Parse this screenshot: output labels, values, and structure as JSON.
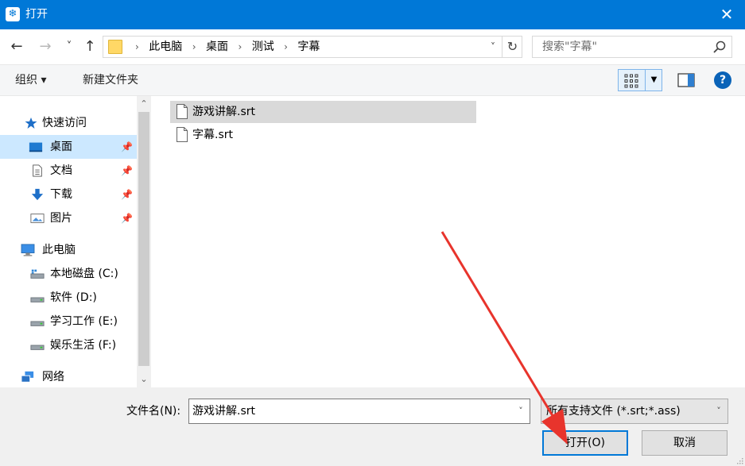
{
  "window": {
    "title": "打开",
    "close_glyph": "✕",
    "app_icon_glyph": "❄"
  },
  "nav": {
    "back_glyph": "←",
    "forward_glyph": "→",
    "recent_glyph": "˅",
    "up_glyph": "↑",
    "breadcrumb": [
      "此电脑",
      "桌面",
      "测试",
      "字幕"
    ],
    "breadcrumb_sep": "›",
    "dropdown_glyph": "˅",
    "refresh_glyph": "↻",
    "search_placeholder": "搜索\"字幕\""
  },
  "toolbar": {
    "organize": "组织 ▾",
    "new_folder": "新建文件夹",
    "view_dd_glyph": "▼",
    "help_glyph": "?"
  },
  "sidebar": {
    "scroll_up": "⌃",
    "scroll_down": "⌄",
    "pin_glyph": "📌",
    "items": [
      {
        "label": "快速访问",
        "icon": "star-icon"
      },
      {
        "label": "桌面",
        "icon": "desktop-icon",
        "pinned": true,
        "selected": true
      },
      {
        "label": "文档",
        "icon": "document-icon",
        "pinned": true
      },
      {
        "label": "下载",
        "icon": "download-icon",
        "pinned": true
      },
      {
        "label": "图片",
        "icon": "picture-icon",
        "pinned": true
      },
      {
        "label": "此电脑",
        "icon": "computer-icon"
      },
      {
        "label": "本地磁盘 (C:)",
        "icon": "system-drive-icon"
      },
      {
        "label": "软件 (D:)",
        "icon": "drive-icon"
      },
      {
        "label": "学习工作 (E:)",
        "icon": "drive-icon"
      },
      {
        "label": "娱乐生活 (F:)",
        "icon": "drive-icon"
      },
      {
        "label": "网络",
        "icon": "network-icon"
      }
    ]
  },
  "files": [
    {
      "name": "游戏讲解.srt",
      "selected": true
    },
    {
      "name": "字幕.srt",
      "selected": false
    }
  ],
  "bottom": {
    "filename_label": "文件名(N):",
    "filename_value": "游戏讲解.srt",
    "filetype_value": "所有支持文件 (*.srt;*.ass)",
    "dropdown_glyph": "˅",
    "open_button": "打开(O)",
    "cancel_button": "取消"
  },
  "colors": {
    "accent": "#0078d7",
    "annotation_arrow": "#e8342c"
  }
}
